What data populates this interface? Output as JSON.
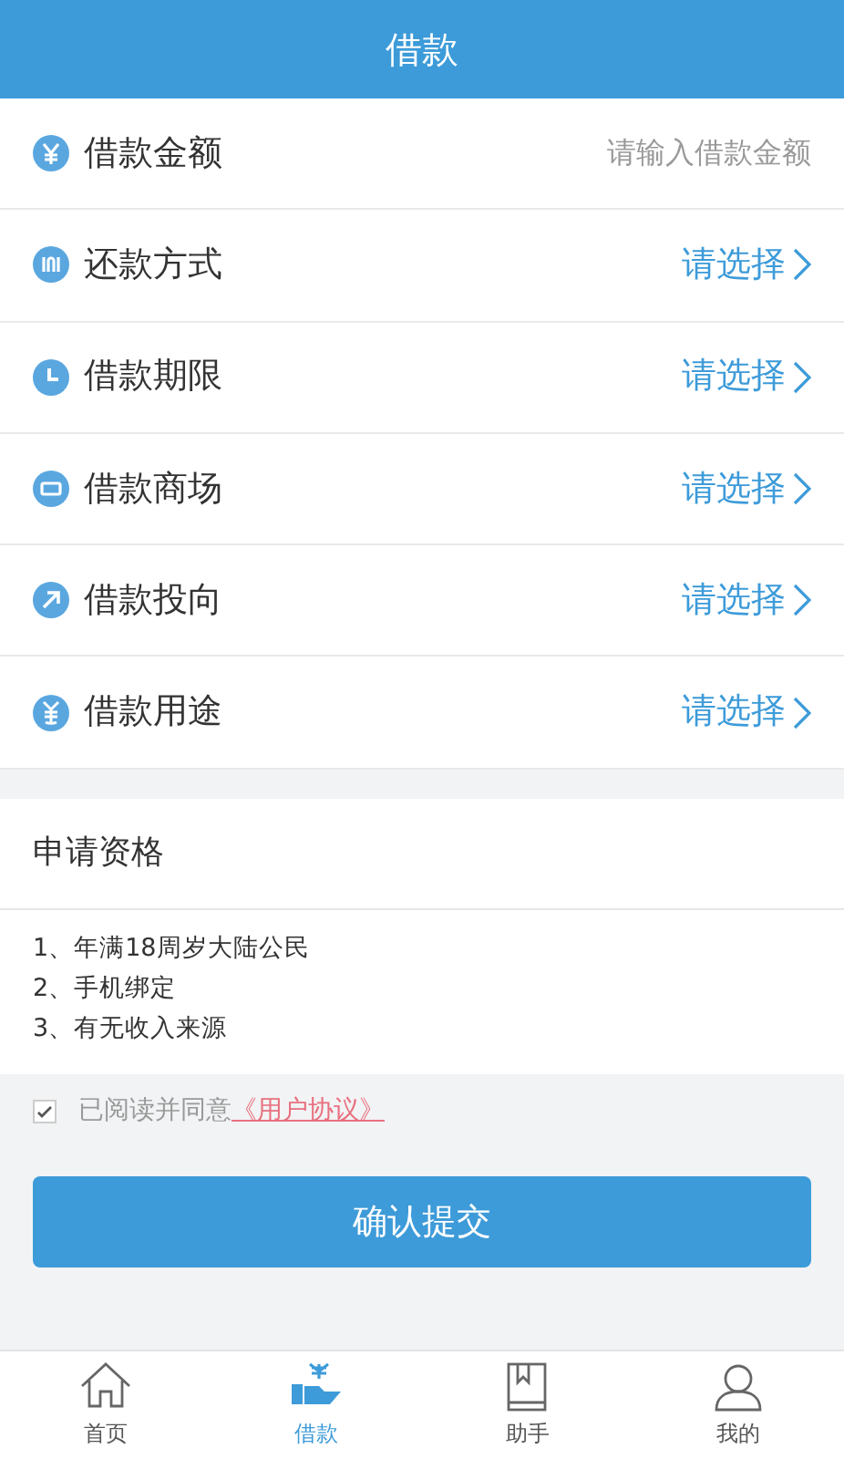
{
  "header": {
    "title": "借款"
  },
  "fields": [
    {
      "kind": "input",
      "label": "借款金额",
      "placeholder": "请输入借款金额"
    },
    {
      "kind": "select",
      "label": "还款方式",
      "value": "请选择"
    },
    {
      "kind": "select",
      "label": "借款期限",
      "value": "请选择"
    },
    {
      "kind": "select",
      "label": "借款商场",
      "value": "请选择"
    },
    {
      "kind": "select",
      "label": "借款投向",
      "value": "请选择"
    },
    {
      "kind": "select",
      "label": "借款用途",
      "value": "请选择"
    }
  ],
  "qualification": {
    "title": "申请资格",
    "items": [
      "1、年满18周岁大陆公民",
      "2、手机绑定",
      "3、有无收入来源"
    ]
  },
  "agreement": {
    "checked": true,
    "text": "已阅读并同意",
    "link": "《用户协议》"
  },
  "submit_button": "确认提交",
  "tabs": [
    {
      "label": "首页",
      "selected": false
    },
    {
      "label": "借款",
      "selected": true
    },
    {
      "label": "助手",
      "selected": false
    },
    {
      "label": "我的",
      "selected": false
    }
  ]
}
